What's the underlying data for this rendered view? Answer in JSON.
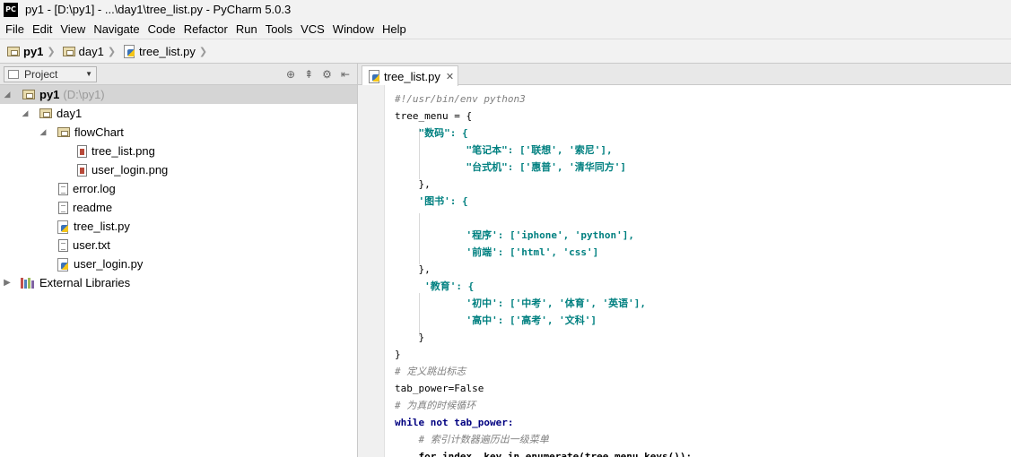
{
  "window": {
    "title": "py1 - [D:\\py1] - ...\\day1\\tree_list.py - PyCharm 5.0.3",
    "logo": "PC"
  },
  "menu": [
    "File",
    "Edit",
    "View",
    "Navigate",
    "Code",
    "Refactor",
    "Run",
    "Tools",
    "VCS",
    "Window",
    "Help"
  ],
  "breadcrumb": [
    "py1",
    "day1",
    "tree_list.py"
  ],
  "project_panel": {
    "label": "Project"
  },
  "tree": {
    "root": {
      "name": "py1",
      "path": "(D:\\py1)"
    },
    "day1": "day1",
    "flowchart": "flowChart",
    "tree_png": "tree_list.png",
    "login_png": "user_login.png",
    "error_log": "error.log",
    "readme": "readme",
    "tree_py": "tree_list.py",
    "user_txt": "user.txt",
    "login_py": "user_login.py",
    "ext_libs": "External Libraries"
  },
  "editor": {
    "tab_label": "tree_list.py",
    "lines": [
      "#!/usr/bin/env python3",
      "tree_menu = {",
      "    \"数码\": {",
      "            \"笔记本\": ['联想', '索尼'],",
      "            \"台式机\": ['惠普', '清华同方']",
      "    },",
      "    '图书': {",
      "",
      "            '程序': ['iphone', 'python'],",
      "            '前端': ['html', 'css']",
      "    },",
      "     '教育': {",
      "            '初中': ['中考', '体育', '英语'],",
      "            '高中': ['高考', '文科']",
      "    }",
      "}",
      "# 定义跳出标志",
      "tab_power=False",
      "# 为真的时候循环",
      "while not tab_power:",
      "    # 索引计数器遍历出一级菜单",
      "    for index, key in enumerate(tree_menu.keys()):"
    ]
  }
}
